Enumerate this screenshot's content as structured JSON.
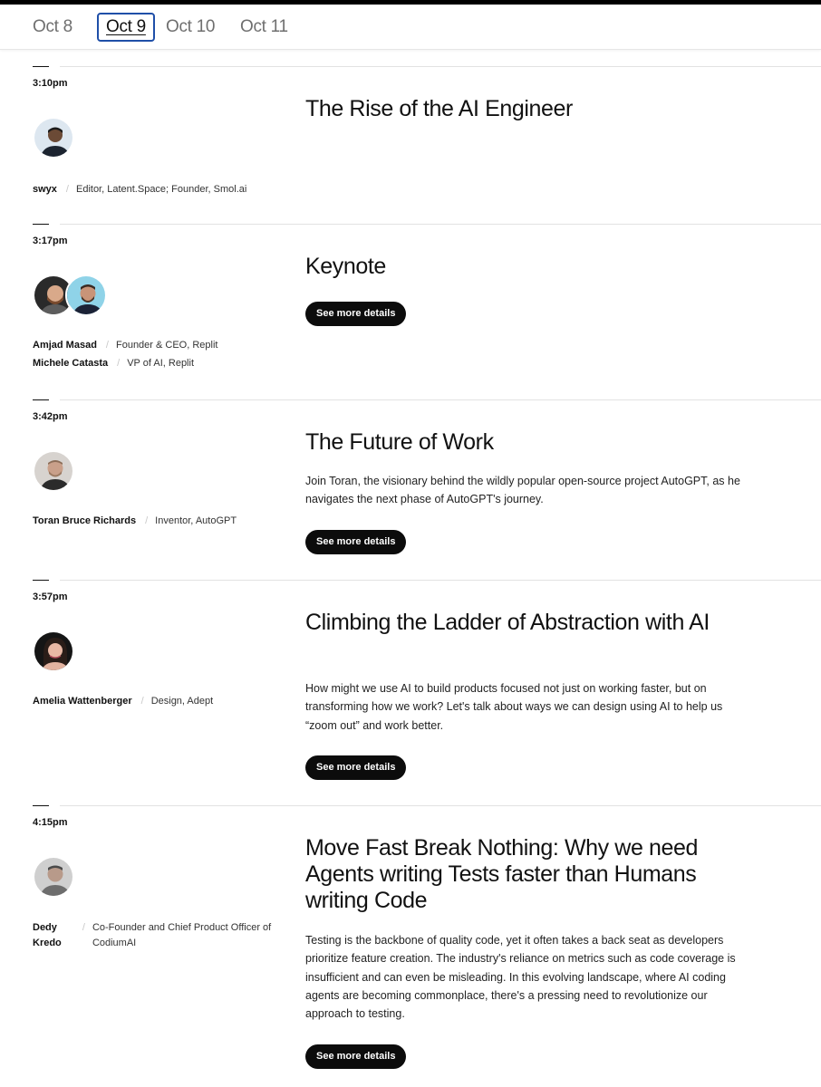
{
  "date_tabs": [
    "Oct 8",
    "Oct 9",
    "Oct 10",
    "Oct 11"
  ],
  "active_tab": "Oct 9",
  "sessions": [
    {
      "time": "3:10pm",
      "title": "The Rise of the AI Engineer",
      "speakers": [
        {
          "name": "swyx",
          "role": "Editor, Latent.Space; Founder, Smol.ai"
        }
      ]
    },
    {
      "time": "3:17pm",
      "title": "Keynote",
      "button": "See more details",
      "speakers": [
        {
          "name": "Amjad Masad",
          "role": "Founder & CEO, Replit"
        },
        {
          "name": "Michele Catasta",
          "role": "VP of AI, Replit"
        }
      ]
    },
    {
      "time": "3:42pm",
      "title": "The Future of Work",
      "description": "Join Toran, the visionary behind the wildly popular open-source project AutoGPT, as he navigates the next phase of AutoGPT's journey.",
      "button": "See more details",
      "speakers": [
        {
          "name": "Toran Bruce Richards",
          "role": "Inventor, AutoGPT"
        }
      ]
    },
    {
      "time": "3:57pm",
      "title": "Climbing the Ladder of Abstraction with AI",
      "description": "How might we use AI to build products focused not just on working faster, but on transforming how we work? Let's talk about ways we can design using AI to help us “zoom out” and work better.",
      "button": "See more details",
      "speakers": [
        {
          "name": "Amelia Wattenberger",
          "role": "Design, Adept"
        }
      ]
    },
    {
      "time": "4:15pm",
      "title": "Move Fast Break Nothing: Why we need Agents writing Tests faster than Humans writing Code",
      "description": "Testing is the backbone of quality code, yet it often takes a back seat as developers prioritize feature creation. The industry's reliance on metrics such as code coverage is insufficient and can even be misleading. In this evolving landscape, where AI coding agents are becoming commonplace, there's a pressing need to revolutionize our approach to testing.",
      "button": "See more details",
      "speakers": [
        {
          "name": "Dedy Kredo",
          "role": "Co-Founder and Chief Product Officer of CodiumAI"
        }
      ]
    }
  ]
}
